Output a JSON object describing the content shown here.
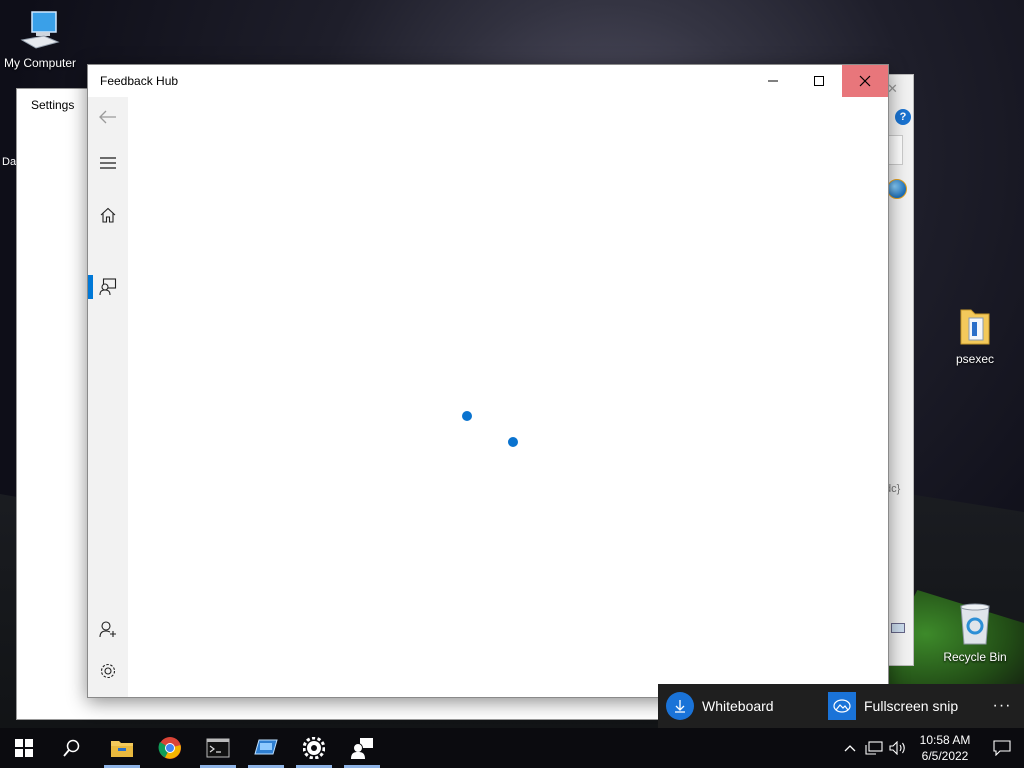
{
  "desktop": {
    "icons": [
      {
        "label": "My Computer"
      },
      {
        "label": "psexec"
      },
      {
        "label": "Recycle Bin"
      }
    ],
    "side_fragment": "Da"
  },
  "settings_window": {
    "title": "Settings"
  },
  "background_window": {
    "code_fragment": "dc}"
  },
  "feedback_hub": {
    "title": "Feedback Hub",
    "accent_color": "#0078d7",
    "close_hover_color": "#e8767b",
    "nav": [
      "back-arrow-icon",
      "hamburger-menu-icon",
      "home-icon",
      "feedback-icon",
      "add-user-icon",
      "settings-gear-icon"
    ],
    "status": "loading"
  },
  "snip_toast": {
    "option1": "Whiteboard",
    "option2": "Fullscreen snip",
    "more": "···"
  },
  "taskbar": {
    "apps": [
      "Start",
      "Search",
      "File Explorer",
      "Google Chrome",
      "Command Prompt",
      "Remote Desktop",
      "Settings",
      "Feedback Hub"
    ],
    "time": "10:58 AM",
    "date": "6/5/2022"
  }
}
